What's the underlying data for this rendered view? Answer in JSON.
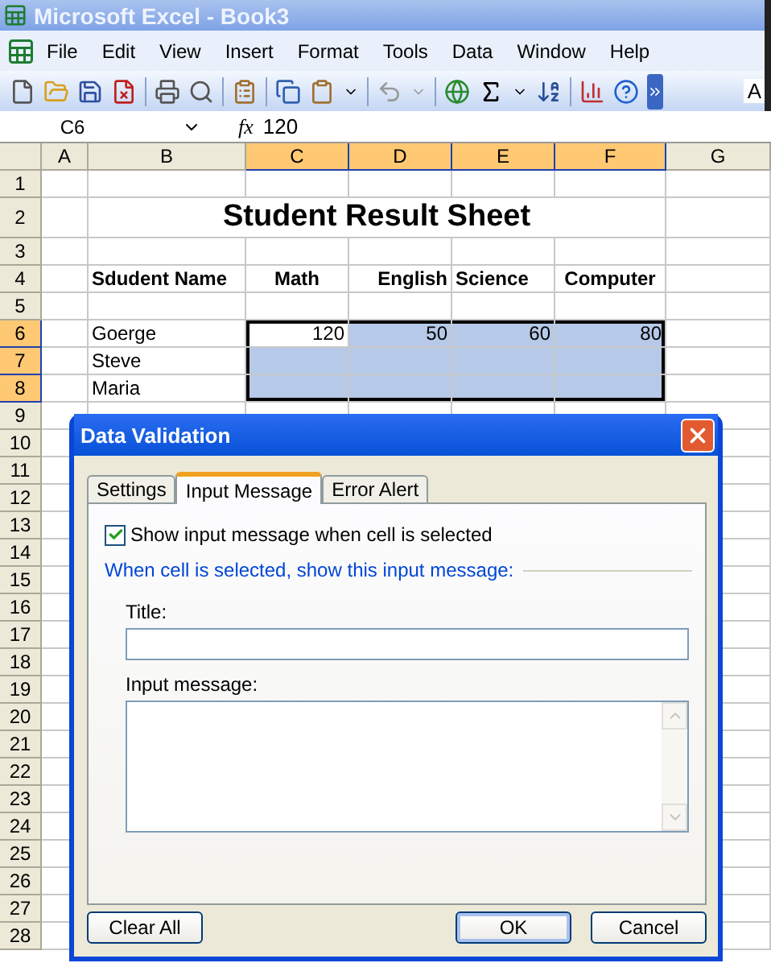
{
  "window": {
    "title": "Microsoft Excel - Book3"
  },
  "menu": [
    "File",
    "Edit",
    "View",
    "Insert",
    "Format",
    "Tools",
    "Data",
    "Window",
    "Help"
  ],
  "toolbar": {
    "font_box": "A"
  },
  "formula_bar": {
    "name_box": "C6",
    "fx": "fx",
    "value": "120"
  },
  "sheet": {
    "columns": [
      {
        "label": "A",
        "selected": false
      },
      {
        "label": "B",
        "selected": false
      },
      {
        "label": "C",
        "selected": true
      },
      {
        "label": "D",
        "selected": true
      },
      {
        "label": "E",
        "selected": true
      },
      {
        "label": "F",
        "selected": true
      },
      {
        "label": "G",
        "selected": false
      }
    ],
    "rows": [
      {
        "label": "1",
        "selected": false,
        "kind": "data",
        "cells": []
      },
      {
        "label": "2",
        "selected": false,
        "kind": "title",
        "title": "Student Result Sheet",
        "cells": []
      },
      {
        "label": "3",
        "selected": false,
        "kind": "data",
        "cells": []
      },
      {
        "label": "4",
        "selected": false,
        "kind": "header",
        "cells": [
          null,
          {
            "text": "Sdudent Name",
            "kind": "left"
          },
          {
            "text": "Math",
            "kind": "center"
          },
          {
            "text": "English",
            "kind": "right"
          },
          {
            "text": "Science",
            "kind": "left"
          },
          {
            "text": "Computer",
            "kind": "center"
          },
          null
        ]
      },
      {
        "label": "5",
        "selected": false,
        "kind": "data",
        "cells": []
      },
      {
        "label": "6",
        "selected": true,
        "kind": "data",
        "cells": [
          null,
          {
            "text": "Goerge",
            "kind": "left"
          },
          {
            "text": "120",
            "kind": "right"
          },
          {
            "text": "50",
            "kind": "right"
          },
          {
            "text": "60",
            "kind": "right"
          },
          {
            "text": "80",
            "kind": "right"
          },
          null
        ]
      },
      {
        "label": "7",
        "selected": true,
        "kind": "data",
        "cells": [
          null,
          {
            "text": "Steve",
            "kind": "left"
          }
        ]
      },
      {
        "label": "8",
        "selected": true,
        "kind": "data",
        "cells": [
          null,
          {
            "text": "Maria",
            "kind": "left"
          }
        ]
      },
      {
        "label": "9",
        "selected": false,
        "kind": "data",
        "cells": []
      },
      {
        "label": "10",
        "selected": false,
        "kind": "data",
        "cells": []
      },
      {
        "label": "11",
        "selected": false,
        "kind": "data",
        "cells": []
      },
      {
        "label": "12",
        "selected": false,
        "kind": "data",
        "cells": []
      },
      {
        "label": "13",
        "selected": false,
        "kind": "data",
        "cells": []
      },
      {
        "label": "14",
        "selected": false,
        "kind": "data",
        "cells": []
      },
      {
        "label": "15",
        "selected": false,
        "kind": "data",
        "cells": []
      },
      {
        "label": "16",
        "selected": false,
        "kind": "data",
        "cells": []
      },
      {
        "label": "17",
        "selected": false,
        "kind": "data",
        "cells": []
      },
      {
        "label": "18",
        "selected": false,
        "kind": "data",
        "cells": []
      },
      {
        "label": "19",
        "selected": false,
        "kind": "data",
        "cells": []
      },
      {
        "label": "20",
        "selected": false,
        "kind": "data",
        "cells": []
      },
      {
        "label": "21",
        "selected": false,
        "kind": "data",
        "cells": []
      },
      {
        "label": "22",
        "selected": false,
        "kind": "data",
        "cells": []
      },
      {
        "label": "23",
        "selected": false,
        "kind": "data",
        "cells": []
      },
      {
        "label": "24",
        "selected": false,
        "kind": "data",
        "cells": []
      },
      {
        "label": "25",
        "selected": false,
        "kind": "data",
        "cells": []
      },
      {
        "label": "26",
        "selected": false,
        "kind": "data",
        "cells": []
      },
      {
        "label": "27",
        "selected": false,
        "kind": "data",
        "cells": []
      },
      {
        "label": "28",
        "selected": false,
        "kind": "data",
        "cells": []
      }
    ]
  },
  "dialog": {
    "title": "Data Validation",
    "tabs": [
      {
        "label": "Settings",
        "selected": false
      },
      {
        "label": "Input Message",
        "selected": true
      },
      {
        "label": "Error Alert",
        "selected": false
      }
    ],
    "checkbox": {
      "label": "Show input message when cell is selected",
      "checked": true
    },
    "group_label": "When cell is selected, show this input message:",
    "title_field": {
      "label": "Title:"
    },
    "message_field": {
      "label": "Input message:"
    },
    "buttons": [
      {
        "label": "Clear All",
        "default": false
      },
      {
        "label": "OK",
        "default": true
      },
      {
        "label": "Cancel",
        "default": false
      }
    ]
  }
}
